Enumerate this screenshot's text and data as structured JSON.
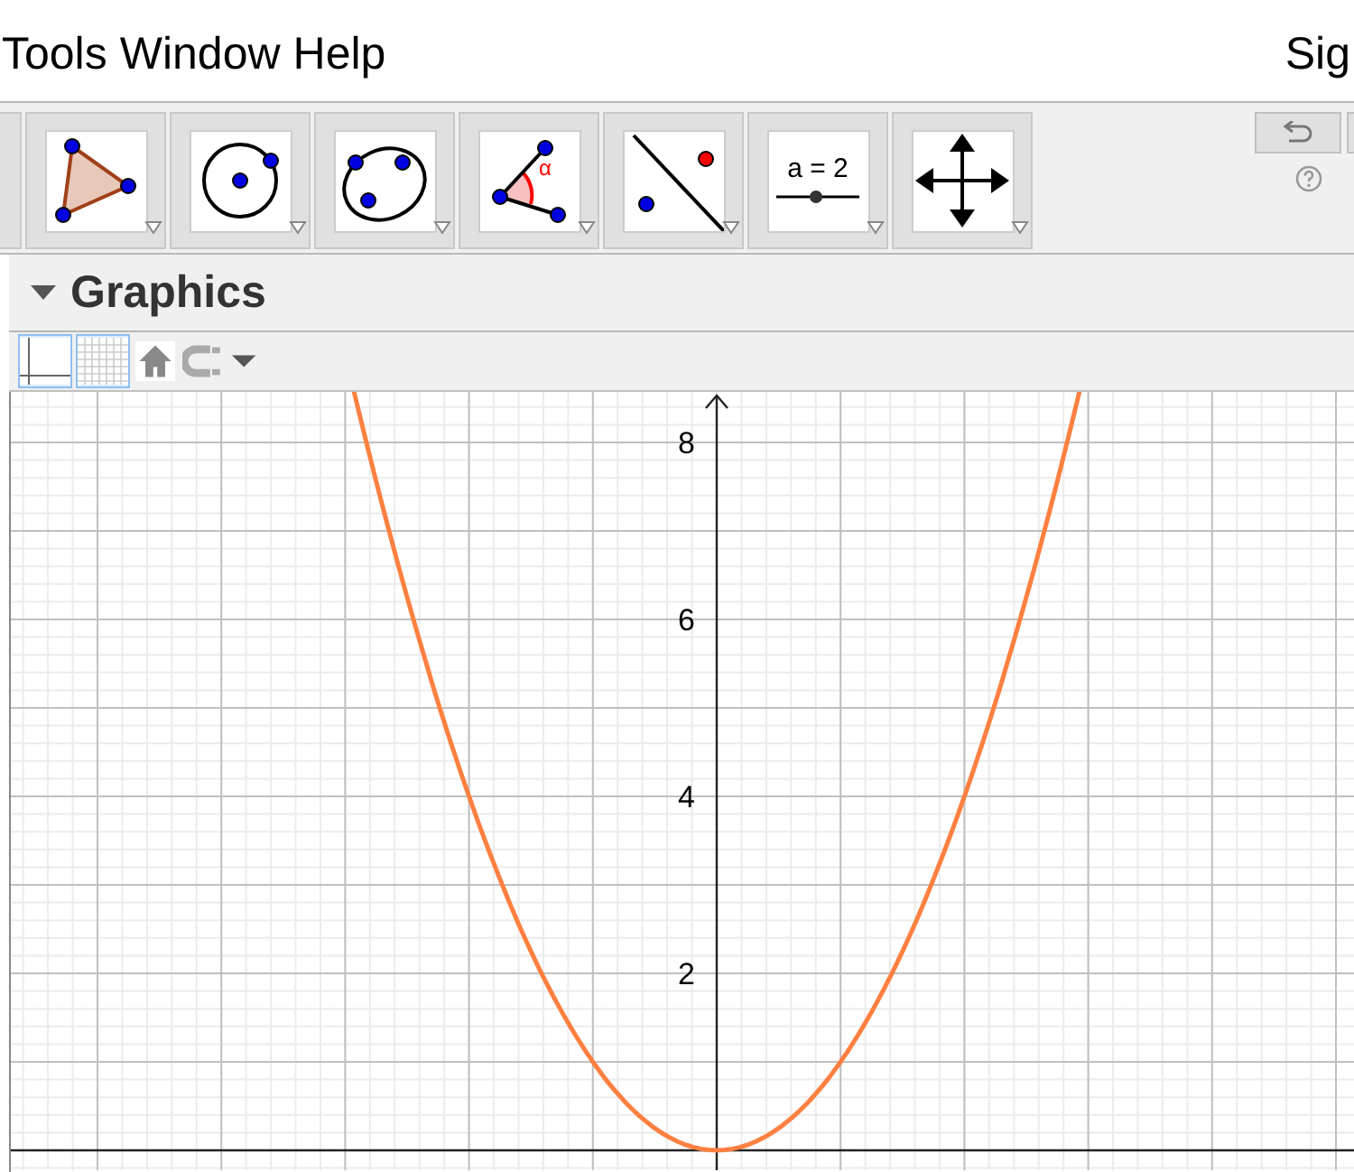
{
  "menu_bar": {
    "items": [
      "Tools",
      "Window",
      "Help"
    ],
    "sign_in": "Sig"
  },
  "toolbar": {
    "tools": [
      {
        "kind": "partial"
      },
      {
        "kind": "polygon"
      },
      {
        "kind": "circle"
      },
      {
        "kind": "conic"
      },
      {
        "kind": "angle",
        "label": "α"
      },
      {
        "kind": "line-point"
      },
      {
        "kind": "slider",
        "label": "a = 2"
      },
      {
        "kind": "move"
      }
    ]
  },
  "graphics": {
    "title": "Graphics",
    "style_buttons": [
      {
        "kind": "axes",
        "selected": true
      },
      {
        "kind": "grid",
        "selected": true
      },
      {
        "kind": "home",
        "selected": false
      },
      {
        "kind": "capture",
        "selected": false
      }
    ],
    "y_axis_labels": [
      "8",
      "6",
      "4",
      "2"
    ]
  }
}
